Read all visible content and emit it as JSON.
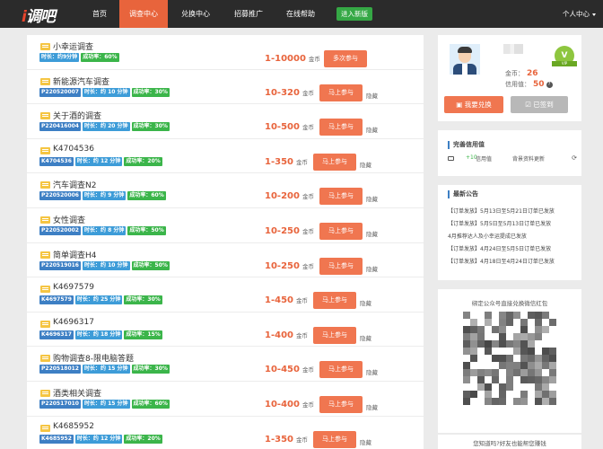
{
  "nav": {
    "logo": "调吧",
    "items": [
      {
        "label": "首页",
        "active": false
      },
      {
        "label": "调查中心",
        "active": true
      },
      {
        "label": "兑换中心",
        "active": false
      },
      {
        "label": "招募推广",
        "active": false
      },
      {
        "label": "在线帮助",
        "active": false
      }
    ],
    "new_version": "进入新版",
    "user_center": "个人中心"
  },
  "surveys": [
    {
      "title": "小幸运调查",
      "id": "",
      "time": "时长：约9分钟",
      "rate": "成功率：60%",
      "reward": "1-10000",
      "unit": "金币",
      "action": "多次参与",
      "hide": ""
    },
    {
      "title": "新能源汽车调查",
      "id": "P220520007",
      "time": "时长：约 10 分钟",
      "rate": "成功率：30%",
      "reward": "10-320",
      "unit": "金币",
      "action": "马上参与",
      "hide": "隐藏"
    },
    {
      "title": "关于酒的调查",
      "id": "P220416004",
      "time": "时长：约 20 分钟",
      "rate": "成功率：30%",
      "reward": "10-500",
      "unit": "金币",
      "action": "马上参与",
      "hide": "隐藏"
    },
    {
      "title": "K4704536",
      "id": "K4704536",
      "time": "时长：约 12 分钟",
      "rate": "成功率：20%",
      "reward": "1-350",
      "unit": "金币",
      "action": "马上参与",
      "hide": "隐藏"
    },
    {
      "title": "汽车调查N2",
      "id": "P220520006",
      "time": "时长：约 9 分钟",
      "rate": "成功率：60%",
      "reward": "10-200",
      "unit": "金币",
      "action": "马上参与",
      "hide": "隐藏"
    },
    {
      "title": "女性调查",
      "id": "P220520002",
      "time": "时长：约 8 分钟",
      "rate": "成功率：50%",
      "reward": "10-250",
      "unit": "金币",
      "action": "马上参与",
      "hide": "隐藏"
    },
    {
      "title": "简单调查H4",
      "id": "P220519016",
      "time": "时长：约 10 分钟",
      "rate": "成功率：50%",
      "reward": "10-250",
      "unit": "金币",
      "action": "马上参与",
      "hide": "隐藏"
    },
    {
      "title": "K4697579",
      "id": "K4697579",
      "time": "时长：约 25 分钟",
      "rate": "成功率：30%",
      "reward": "1-450",
      "unit": "金币",
      "action": "马上参与",
      "hide": "隐藏"
    },
    {
      "title": "K4696317",
      "id": "K4696317",
      "time": "时长：约 18 分钟",
      "rate": "成功率：15%",
      "reward": "1-400",
      "unit": "金币",
      "action": "马上参与",
      "hide": "隐藏"
    },
    {
      "title": "购物调查8-限电脑答题",
      "id": "P220518012",
      "time": "时长：约 15 分钟",
      "rate": "成功率：30%",
      "reward": "10-450",
      "unit": "金币",
      "action": "马上参与",
      "hide": "隐藏"
    },
    {
      "title": "酒类相关调查",
      "id": "P220517010",
      "time": "时长：约 15 分钟",
      "rate": "成功率：60%",
      "reward": "10-400",
      "unit": "金币",
      "action": "马上参与",
      "hide": "隐藏"
    },
    {
      "title": "K4685952",
      "id": "K4685952",
      "time": "时长：约 12 分钟",
      "rate": "成功率：20%",
      "reward": "1-350",
      "unit": "金币",
      "action": "马上参与",
      "hide": "隐藏"
    }
  ],
  "profile": {
    "coins_label": "金币：",
    "coins": "26",
    "credit_label": "信用值：",
    "credit": "50",
    "help_glyph": "?",
    "vip_glyph": "V",
    "vip_ribbon": "VIP",
    "exchange_button": "我要兑换",
    "signed_button": "已签到"
  },
  "credit_box": {
    "title": "完善信用值",
    "plus": "+10",
    "label": "信用值",
    "update": "背景资料更新",
    "refresh_glyph": "⟳"
  },
  "notices": {
    "title": "最新公告",
    "items": [
      "【订单发放】5月13日至5月21日订单已发放",
      "【订单发放】5月5日至5月13日订单已发放",
      "4月推荐达人及小幸运提成已发放",
      "【订单发放】4月24日至5月5日订单已发放",
      "【订单发放】4月18日至4月24日订单已发放"
    ]
  },
  "qr": {
    "caption": "绑定公众号直接兑换微信红包"
  },
  "tip": {
    "text": "您知道吗?好友也能帮您赚钱"
  },
  "colors": {
    "accent": "#e8643c",
    "button": "#f07650",
    "nav_bg": "#2b2b2b",
    "green": "#3bb54a",
    "blue": "#3d7fc4"
  }
}
